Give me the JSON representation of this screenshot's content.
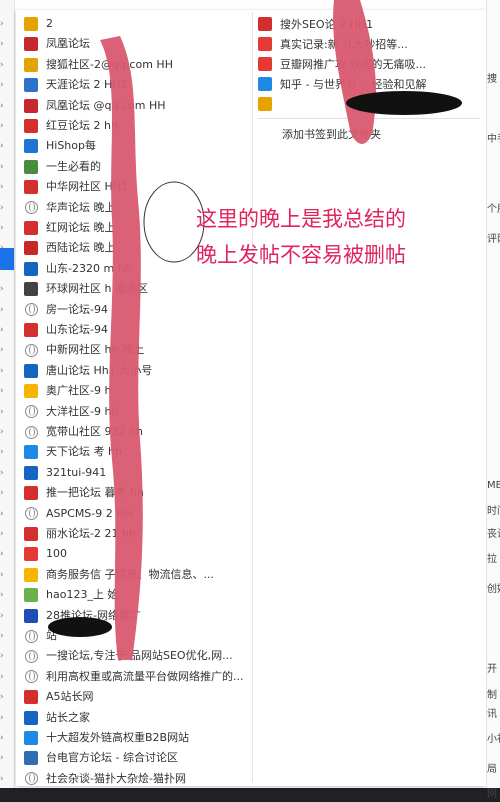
{
  "colors": {
    "accent": "#1a73e8",
    "annotation": "#e0245e",
    "censor_pink": "#d9586f",
    "censor_black": "#111111"
  },
  "left_menu": {
    "items": [
      {
        "label": "2",
        "icon": "gold-icon",
        "color": "#e6a400"
      },
      {
        "label": "凤凰论坛",
        "icon": "phoenix-icon",
        "color": "#c6282e"
      },
      {
        "label": "搜狐社区-2@qq.com HH",
        "icon": "sohu-icon",
        "color": "#e2a400"
      },
      {
        "label": "天涯论坛 2 HH1",
        "icon": "tianya-icon",
        "color": "#2c73c9"
      },
      {
        "label": "凤凰论坛 @qq.com HH",
        "icon": "phoenix-icon",
        "color": "#c6282e"
      },
      {
        "label": "红豆论坛 2 hh",
        "icon": "hongdou-icon",
        "color": "#d32f2f"
      },
      {
        "label": "HiShop每",
        "icon": "hishop-icon",
        "color": "#1d74d4"
      },
      {
        "label": "一生必看的",
        "icon": "yisheng-icon",
        "color": "#4a8c3f"
      },
      {
        "label": "中华网社区 HH1",
        "icon": "china-icon",
        "color": "#d32f2f"
      },
      {
        "label": "华声论坛 晚上",
        "icon": "globe-icon",
        "color": ""
      },
      {
        "label": "红网论坛 晚上",
        "icon": "hongwang-icon",
        "color": "#d32f2f"
      },
      {
        "label": "西陆论坛 晚上",
        "icon": "xilu-icon",
        "color": "#c62828"
      },
      {
        "label": "山东-2320 m hh",
        "icon": "shandong-icon",
        "color": "#1565c0"
      },
      {
        "label": "环球网社区 h 潜水区",
        "icon": "huanqiu-icon",
        "color": "#424242"
      },
      {
        "label": "房一论坛-94",
        "icon": "globe-icon",
        "color": ""
      },
      {
        "label": "山东论坛-94",
        "icon": "shandong2-icon",
        "color": "#d32f2f"
      },
      {
        "label": "中新网社区 hh-晚上",
        "icon": "globe-icon",
        "color": ""
      },
      {
        "label": "唐山论坛 Hh1 大小号",
        "icon": "tangshan-icon",
        "color": "#1565c0"
      },
      {
        "label": "奥广社区-9 h",
        "icon": "aoguang-icon",
        "color": "#f5b400"
      },
      {
        "label": "大洋社区-9 hh",
        "icon": "globe-icon",
        "color": ""
      },
      {
        "label": "宽带山社区 932 hh",
        "icon": "globe-icon",
        "color": ""
      },
      {
        "label": "天下论坛 考 hh",
        "icon": "tianxia-icon",
        "color": "#1e88e5"
      },
      {
        "label": "321tui-941",
        "icon": "tui-icon",
        "color": "#1565c0"
      },
      {
        "label": "推一把论坛 暮考 hh",
        "icon": "tuiyiba-icon",
        "color": "#d32f2f"
      },
      {
        "label": "ASPCMS-9 2 HH",
        "icon": "globe-icon",
        "color": ""
      },
      {
        "label": "丽水论坛-2 21 hh",
        "icon": "lishui-icon",
        "color": "#d32f2f"
      },
      {
        "label": "100",
        "icon": "hundred-icon",
        "color": "#e53935"
      },
      {
        "label": "商务服务信 子信息、物流信息、...",
        "icon": "business-icon",
        "color": "#f5b400"
      },
      {
        "label": "hao123_上 始",
        "icon": "hao123-icon",
        "color": "#6ab04c"
      },
      {
        "label": "28推论坛-网络推广",
        "icon": "tui28-icon",
        "color": "#1e4db7"
      },
      {
        "label": "站",
        "icon": "globe-icon",
        "color": ""
      },
      {
        "label": "一搜论坛,专注于 品网站SEO优化,网...",
        "icon": "globe-icon",
        "color": ""
      },
      {
        "label": "利用高权重或高流量平台做网络推广的...",
        "icon": "globe-icon",
        "color": ""
      },
      {
        "label": "A5站长网",
        "icon": "a5-icon",
        "color": "#d32f2f"
      },
      {
        "label": "站长之家",
        "icon": "chinaz-icon",
        "color": "#1565c0"
      },
      {
        "label": "十大超发外链高权重B2B网站",
        "icon": "shida-icon",
        "color": "#1e88e5"
      },
      {
        "label": "台电官方论坛 - 综合讨论区",
        "icon": "teclast-icon",
        "color": "#2c6db3"
      },
      {
        "label": "社会杂谈-猫扑大杂烩-猫扑网",
        "icon": "globe-icon",
        "color": ""
      }
    ]
  },
  "right_menu": {
    "items": [
      {
        "label": "搜外SEO论 2 HH1",
        "icon": "souwai-icon",
        "color": "#d32f2f"
      },
      {
        "label": "真实记录:新 几大吵招等...",
        "icon": "zhenshi-icon",
        "color": "#e53935"
      },
      {
        "label": "豆瓣网推广攻 效视的无痛吸...",
        "icon": "douban-icon",
        "color": "#e53935"
      },
      {
        "label": "知乎 - 与世界分 、经验和见解",
        "icon": "zhihu-icon",
        "color": "#1e88e5"
      },
      {
        "label": "",
        "icon": "x-icon",
        "color": "#e6a400"
      }
    ],
    "footer": "添加书签到此文件夹"
  },
  "annotation": {
    "line1": "这里的晚上是我总结的",
    "line2": "晚上发帖不容易被删帖"
  },
  "far_right_fragments": [
    "捜",
    "中手",
    "个朋",
    "评网",
    "MB",
    "时间",
    "丧设",
    "拉",
    "创始",
    "开",
    "制",
    "讯",
    "小初",
    "局",
    "网"
  ]
}
